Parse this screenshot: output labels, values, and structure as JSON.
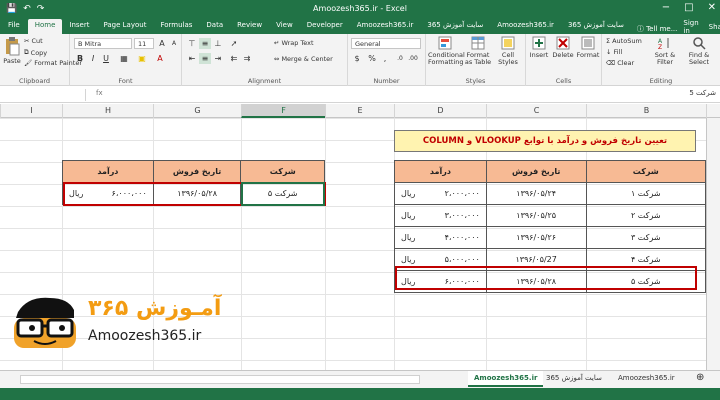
{
  "window": {
    "title": "Amoozesh365.ir - Excel",
    "controls": [
      "−",
      "□",
      "✕"
    ]
  },
  "tabs": [
    {
      "label": "File"
    },
    {
      "label": "Home"
    },
    {
      "label": "Insert"
    },
    {
      "label": "Page Layout"
    },
    {
      "label": "Formulas"
    },
    {
      "label": "Data"
    },
    {
      "label": "Review"
    },
    {
      "label": "View"
    },
    {
      "label": "Developer"
    },
    {
      "label": "Amoozesh365.ir"
    },
    {
      "label": "سایت آموزش 365"
    },
    {
      "label": "Amoozesh365.ir"
    },
    {
      "label": "سایت آموزش 365"
    }
  ],
  "tell_me": "Tell me...",
  "account": "Sign in",
  "share": "Share",
  "ribbon": {
    "clipboard": {
      "label": "Clipboard",
      "paste": "Paste",
      "cut": "Cut",
      "copy": "Copy",
      "format_painter": "Format Painter"
    },
    "font": {
      "label": "Font",
      "name": "B Mitra",
      "size": "11",
      "bold": "B",
      "italic": "I",
      "underline": "U",
      "grow": "A",
      "shrink": "A"
    },
    "alignment": {
      "label": "Alignment",
      "wrap": "Wrap Text",
      "merge": "Merge & Center"
    },
    "number": {
      "label": "Number",
      "format": "General",
      "currency": "$",
      "percent": "%",
      "comma": ","
    },
    "styles": {
      "label": "Styles",
      "conditional": "Conditional Formatting",
      "format_table": "Format as Table",
      "cell_styles": "Cell Styles"
    },
    "cells": {
      "label": "Cells",
      "insert": "Insert",
      "delete": "Delete",
      "format": "Format"
    },
    "editing": {
      "label": "Editing",
      "autosum": "AutoSum",
      "fill": "Fill",
      "clear": "Clear",
      "sort": "Sort & Filter",
      "find": "Find & Select"
    }
  },
  "formula_bar": {
    "fx": "fx",
    "content": "شرکت 5"
  },
  "columns": [
    "I",
    "H",
    "G",
    "F",
    "E",
    "D",
    "C",
    "B"
  ],
  "banner": "تعیین تاریخ فروش و درآمد با توابع VLOOKUP و COLUMN",
  "main_table": {
    "headers": [
      "شرکت",
      "تاریخ فروش",
      "درآمد"
    ],
    "rows": [
      {
        "company": "شرکت ۱",
        "date": "۱۳۹۶/۰۵/۲۴",
        "amount": "۲،۰۰۰،۰۰۰",
        "unit": "ریال"
      },
      {
        "company": "شرکت ۲",
        "date": "۱۳۹۶/۰۵/۲۵",
        "amount": "۳،۰۰۰،۰۰۰",
        "unit": "ریال"
      },
      {
        "company": "شرکت ۳",
        "date": "۱۳۹۶/۰۵/۲۶",
        "amount": "۴،۰۰۰،۰۰۰",
        "unit": "ریال"
      },
      {
        "company": "شرکت ۴",
        "date": "۱۳۹۶/۰۵/27",
        "amount": "۵،۰۰۰،۰۰۰",
        "unit": "ریال"
      },
      {
        "company": "شرکت ۵",
        "date": "۱۳۹۶/۰۵/۲۸",
        "amount": "۶،۰۰۰،۰۰۰",
        "unit": "ریال"
      }
    ]
  },
  "lookup_table": {
    "headers": [
      "شرکت",
      "تاریخ فروش",
      "درآمد"
    ],
    "row": {
      "company": "شرکت ۵",
      "date": "۱۳۹۶/۰۵/۲۸",
      "amount": "۶،۰۰۰،۰۰۰",
      "unit": "ریال"
    }
  },
  "logo": {
    "fa": "آمـوزش ۳۶۵",
    "en": "Amoozesh365.ir"
  },
  "sheets": [
    {
      "label": "Amoozesh365.ir"
    },
    {
      "label": "سایت آموزش 365"
    },
    {
      "label": "Amoozesh365.ir"
    }
  ]
}
